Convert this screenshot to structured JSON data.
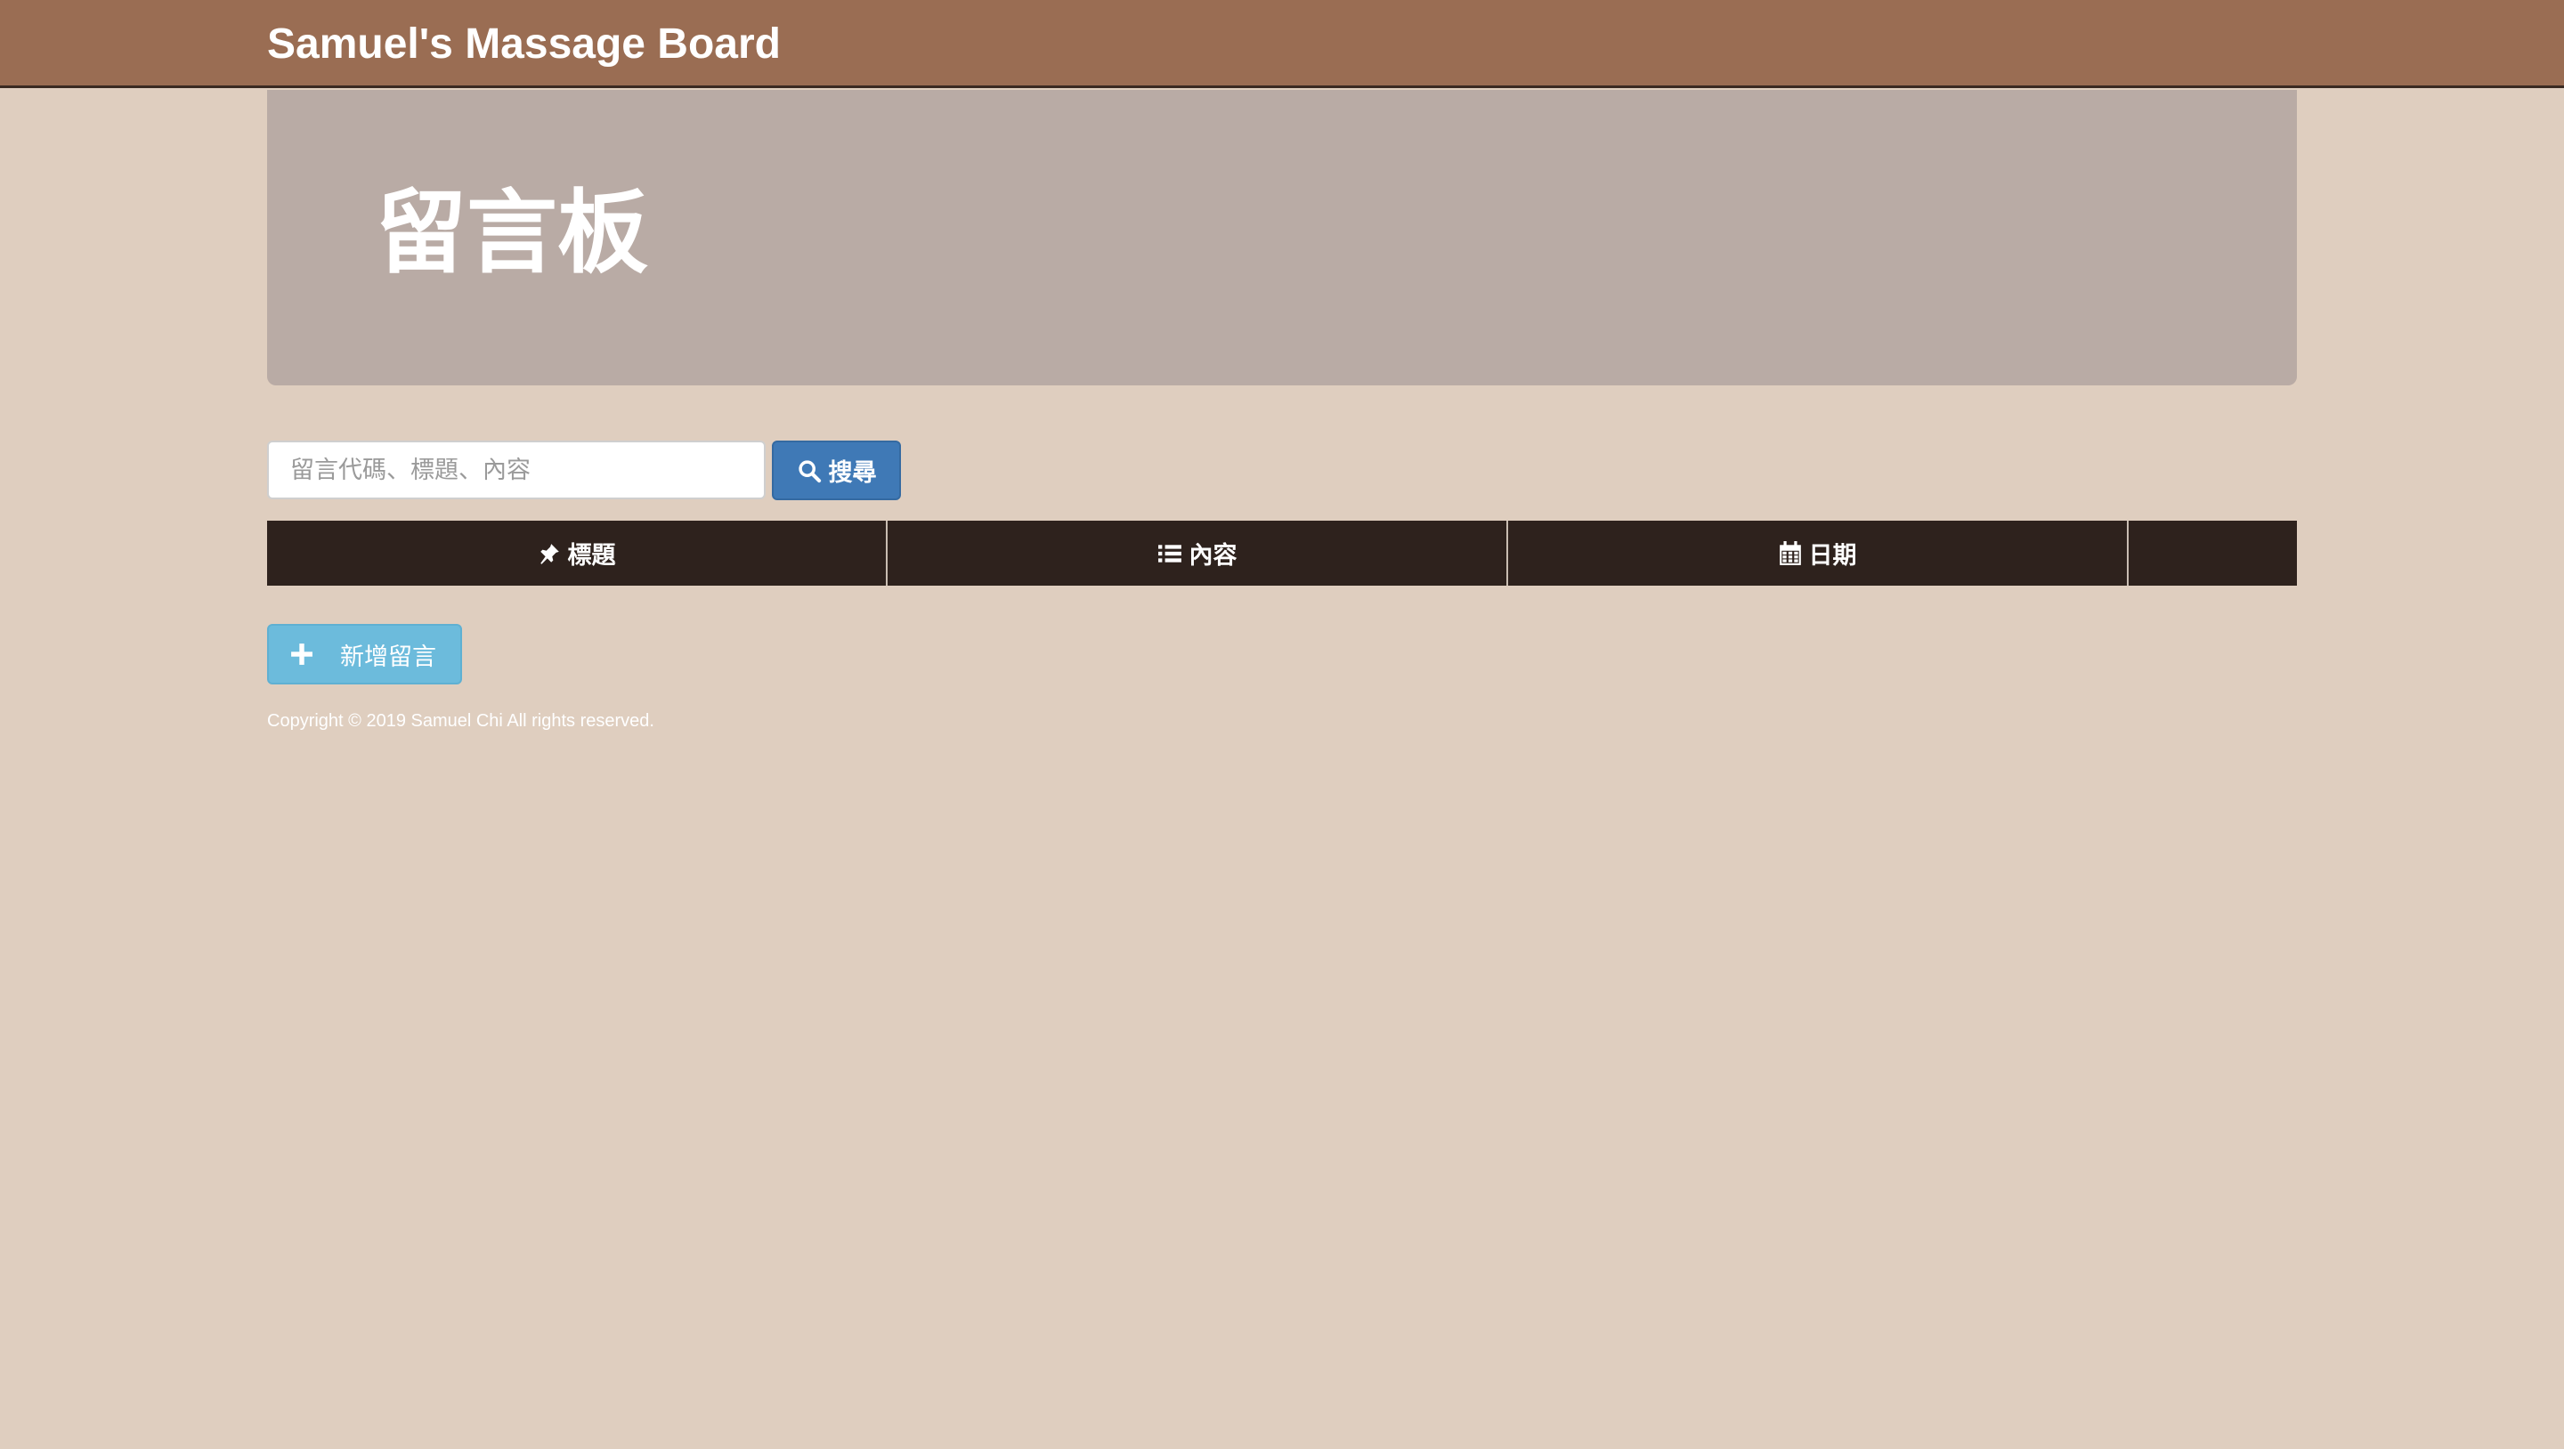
{
  "navbar": {
    "brand": "Samuel's Massage Board"
  },
  "jumbotron": {
    "title": "留言板"
  },
  "search": {
    "placeholder": "留言代碼、標題、內容",
    "value": "",
    "button_label": "搜尋",
    "button_icon": "search-icon"
  },
  "table": {
    "headers": [
      {
        "label": "標題",
        "icon": "pin-icon"
      },
      {
        "label": "內容",
        "icon": "list-icon"
      },
      {
        "label": "日期",
        "icon": "calendar-icon"
      },
      {
        "label": "",
        "icon": ""
      }
    ],
    "rows": []
  },
  "actions": {
    "add_label": "新增留言",
    "add_icon": "plus-icon"
  },
  "footer": {
    "copyright": "Copyright © 2019 Samuel Chi All rights reserved."
  },
  "colors": {
    "navbar": "#9a6d53",
    "page_background": "#dfcebf",
    "jumbotron": "#b9aba5",
    "table_header": "#2e221d",
    "search_button": "#3f79b6",
    "add_button": "#6cbbdc"
  }
}
